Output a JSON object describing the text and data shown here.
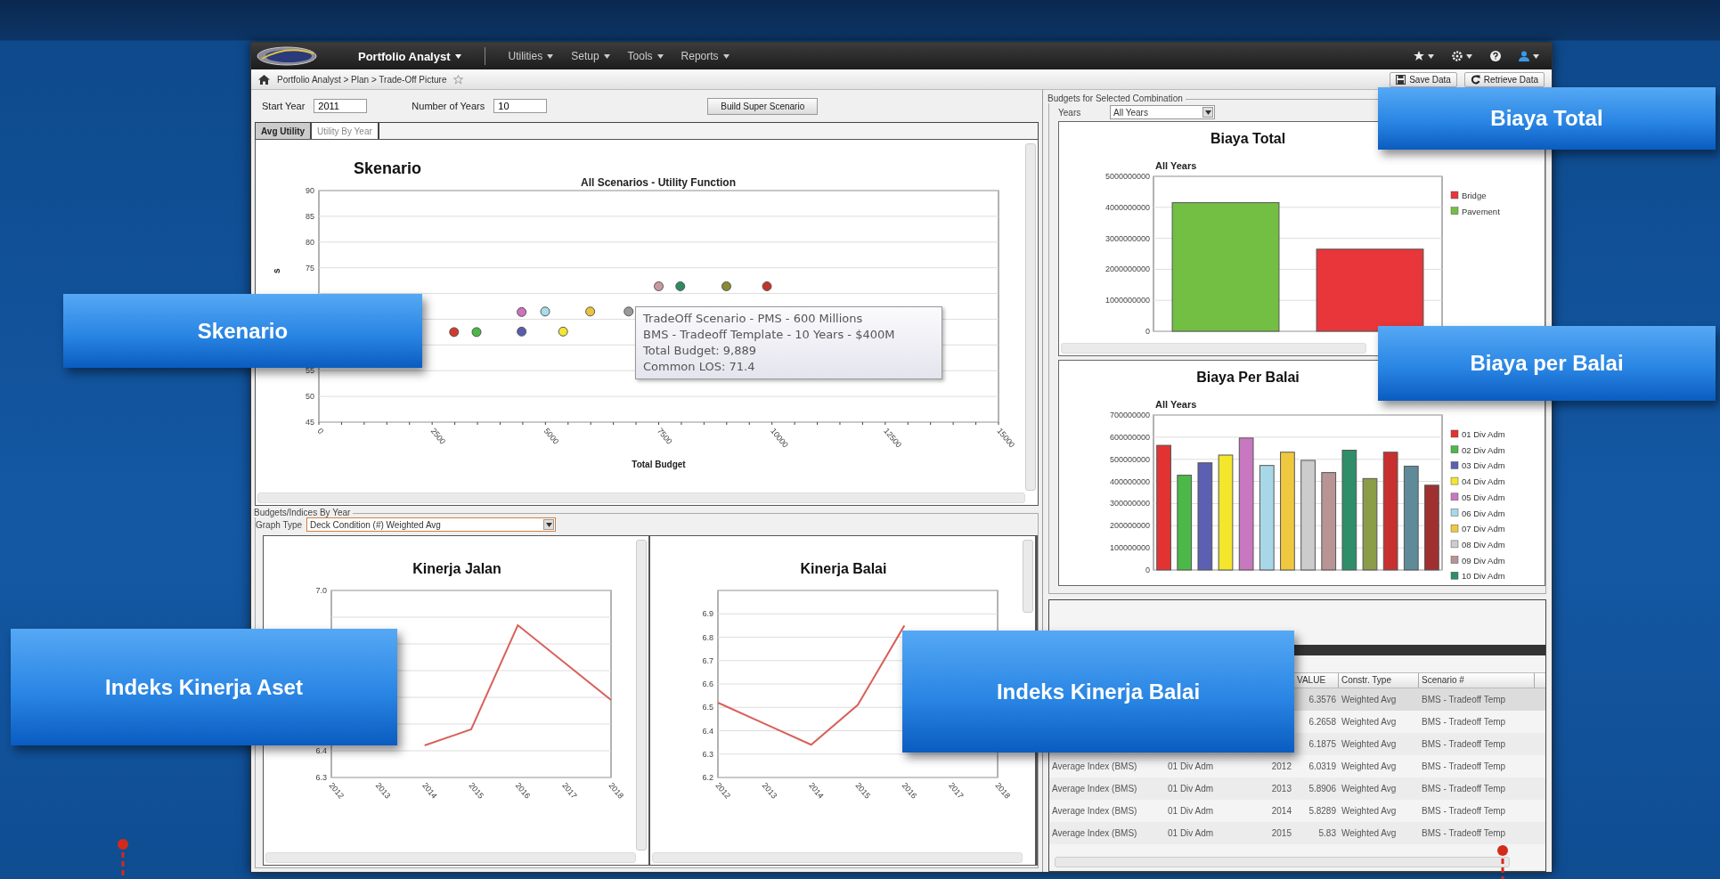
{
  "navbar": {
    "menus": [
      {
        "label": "Portfolio Analyst",
        "kind": "app"
      },
      {
        "label": "Utilities",
        "kind": "menu"
      },
      {
        "label": "Setup",
        "kind": "menu"
      },
      {
        "label": "Tools",
        "kind": "menu"
      },
      {
        "label": "Reports",
        "kind": "menu"
      }
    ]
  },
  "breadcrumb": {
    "path": "Portfolio Analyst > Plan > Trade-Off Picture",
    "buttons": [
      {
        "label": "Save Data",
        "kind": "save"
      },
      {
        "label": "Retrieve Data",
        "kind": "refresh"
      }
    ]
  },
  "scenario_form": {
    "start_year": {
      "label": "Start Year",
      "value": "2011"
    },
    "number_of_years": {
      "label": "Number of Years",
      "value": "10"
    },
    "build_button": "Build Super Scenario"
  },
  "tabs": [
    {
      "label": "Avg Utility",
      "selected": true
    },
    {
      "label": "Utility By Year",
      "selected": false
    }
  ],
  "scatter_panel": {
    "heading": "Skenario",
    "chart_data": {
      "type": "scatter",
      "title": "All Scenarios - Utility Function",
      "xlabel": "Total Budget",
      "ylabel": "s",
      "grid": true,
      "xlim": [
        0,
        15000
      ],
      "ylim": [
        45,
        90
      ],
      "xticks": [
        0,
        2500,
        5000,
        7500,
        10000,
        12500,
        15000
      ],
      "yticks": [
        45,
        50,
        55,
        75,
        80,
        85,
        90
      ],
      "x": [
        2983,
        3480,
        4475,
        4994,
        4475,
        5390,
        5989,
        6836,
        7500,
        7977,
        8994,
        9889
      ],
      "series": [
        {
          "color": "#d23a2e",
          "values": [
            62.5,
            null,
            null,
            null,
            null,
            null,
            null,
            null,
            null,
            null,
            null,
            null
          ]
        },
        {
          "color": "#4cb848",
          "values": [
            null,
            62.5,
            null,
            null,
            null,
            null,
            null,
            null,
            null,
            null,
            null,
            null
          ]
        },
        {
          "color": "#d070c0",
          "values": [
            null,
            null,
            66.4,
            null,
            null,
            null,
            null,
            null,
            null,
            null,
            null,
            null
          ]
        },
        {
          "color": "#a8dcea",
          "values": [
            null,
            null,
            null,
            66.5,
            null,
            null,
            null,
            null,
            null,
            null,
            null,
            null
          ]
        },
        {
          "color": "#5a5cb0",
          "values": [
            null,
            null,
            null,
            null,
            62.6,
            null,
            null,
            null,
            null,
            null,
            null,
            null
          ]
        },
        {
          "color": "#f2e632",
          "values": [
            null,
            null,
            null,
            null,
            null,
            62.6,
            null,
            null,
            null,
            null,
            null,
            null
          ]
        },
        {
          "color": "#e8c440",
          "values": [
            null,
            null,
            null,
            null,
            null,
            null,
            66.5,
            null,
            null,
            null,
            null,
            null
          ]
        },
        {
          "color": "#9a9a9a",
          "values": [
            null,
            null,
            null,
            null,
            null,
            null,
            null,
            66.5,
            null,
            null,
            null,
            null
          ]
        },
        {
          "color": "#c89aa0",
          "values": [
            null,
            null,
            null,
            null,
            null,
            null,
            null,
            null,
            71.4,
            null,
            null,
            null
          ]
        },
        {
          "color": "#2f8a60",
          "values": [
            null,
            null,
            null,
            null,
            null,
            null,
            null,
            null,
            null,
            71.4,
            null,
            null
          ]
        },
        {
          "color": "#8a8a30",
          "values": [
            null,
            null,
            null,
            null,
            null,
            null,
            null,
            null,
            null,
            null,
            71.4,
            null
          ]
        },
        {
          "color": "#c0362a",
          "values": [
            null,
            null,
            null,
            null,
            null,
            null,
            null,
            null,
            null,
            null,
            null,
            71.4
          ]
        }
      ]
    },
    "tooltip": [
      "TradeOff Scenario - PMS - 600 Millions",
      "BMS - Tradeoff Template - 10 Years - $400M",
      "Total Budget: 9,889",
      "Common LOS: 71.4"
    ]
  },
  "indices_group": {
    "legend": "Budgets/Indices By Year",
    "graph_type": {
      "label": "Graph Type",
      "value": "Deck Condition (#) Weighted Avg"
    },
    "charts": [
      {
        "heading": "Kinerja Jalan",
        "chart_data": {
          "type": "line",
          "grid": true,
          "x": [
            "2012",
            "2013",
            "2014",
            "2015",
            "2016",
            "2017",
            "2018"
          ],
          "ylim": [
            6.3,
            7.0
          ],
          "yticks": [
            {
              "value": 6.3,
              "label": "6.3"
            },
            {
              "value": 6.4,
              "label": "6.4"
            },
            {
              "value": 7.0,
              "label": "7.0"
            }
          ],
          "series": [
            {
              "color": "#d9605a",
              "values": [
                null,
                null,
                6.42,
                6.48,
                6.87,
                6.73,
                6.59
              ]
            }
          ]
        }
      },
      {
        "heading": "Kinerja Balai",
        "chart_data": {
          "type": "line",
          "grid": true,
          "x": [
            "2012",
            "2013",
            "2014",
            "2015",
            "2016",
            "2017",
            "2018"
          ],
          "ylim": [
            6.2,
            7.0
          ],
          "yticks": [
            {
              "value": 6.2,
              "label": "6.2"
            },
            {
              "value": 6.3,
              "label": "6.3"
            },
            {
              "value": 6.4,
              "label": "6.4"
            },
            {
              "value": 6.5,
              "label": "6.5"
            },
            {
              "value": 6.6,
              "label": "6.6"
            },
            {
              "value": 6.7,
              "label": "6.7"
            },
            {
              "value": 6.8,
              "label": "6.8"
            },
            {
              "value": 6.9,
              "label": "6.9"
            }
          ],
          "series": [
            {
              "color": "#d9605a",
              "values": [
                6.52,
                6.43,
                6.34,
                6.51,
                6.85,
                null,
                null
              ]
            }
          ]
        }
      }
    ]
  },
  "budgets_group": {
    "legend": "Budgets for Selected Combination",
    "years": {
      "label": "Years",
      "value": "All Years"
    },
    "total_chart": {
      "heading": "Biaya Total",
      "subtitle": "All Years",
      "chart_data": {
        "type": "bar",
        "grid": true,
        "legend": "right",
        "ylim": [
          0,
          5000000000
        ],
        "yticks": [
          {
            "value": 0,
            "label": "0"
          },
          {
            "value": 1000000000,
            "label": "1000000000"
          },
          {
            "value": 2000000000,
            "label": "2000000000"
          },
          {
            "value": 3000000000,
            "label": "3000000000"
          },
          {
            "value": 4000000000,
            "label": "4000000000"
          },
          {
            "value": 5000000000,
            "label": "5000000000"
          }
        ],
        "series": [
          {
            "name": "Bridge",
            "color": "#e8363a",
            "values": [
              null,
              2650000000
            ]
          },
          {
            "name": "Pavement",
            "color": "#72bf44",
            "values": [
              4150000000,
              null
            ]
          }
        ]
      }
    },
    "division_chart": {
      "heading": "Biaya Per Balai",
      "subtitle": "All Years",
      "chart_data": {
        "type": "bar",
        "grid": true,
        "legend": "right",
        "ylim": [
          0,
          700000000
        ],
        "yticks": [
          {
            "value": 0,
            "label": "0"
          },
          {
            "value": 100000000,
            "label": "100000000"
          },
          {
            "value": 200000000,
            "label": "200000000"
          },
          {
            "value": 300000000,
            "label": "300000000"
          },
          {
            "value": 400000000,
            "label": "400000000"
          },
          {
            "value": 500000000,
            "label": "500000000"
          },
          {
            "value": 600000000,
            "label": "600000000"
          },
          {
            "value": 700000000,
            "label": "700000000"
          }
        ],
        "series": [
          {
            "name": "01 Div Adm",
            "color": "#e23232",
            "values": [
              563000000,
              null,
              null,
              null,
              null,
              null,
              null,
              null,
              null,
              null,
              null,
              null,
              null,
              null
            ]
          },
          {
            "name": "02 Div Adm",
            "color": "#4cb848",
            "values": [
              null,
              428000000,
              null,
              null,
              null,
              null,
              null,
              null,
              null,
              null,
              null,
              null,
              null,
              null
            ]
          },
          {
            "name": "03 Div Adm",
            "color": "#5c5fb2",
            "values": [
              null,
              null,
              484000000,
              null,
              null,
              null,
              null,
              null,
              null,
              null,
              null,
              null,
              null,
              null
            ]
          },
          {
            "name": "04 Div Adm",
            "color": "#f4e62c",
            "values": [
              null,
              null,
              null,
              519000000,
              null,
              null,
              null,
              null,
              null,
              null,
              null,
              null,
              null,
              null
            ]
          },
          {
            "name": "05 Div Adm",
            "color": "#c878c0",
            "values": [
              null,
              null,
              null,
              null,
              596000000,
              null,
              null,
              null,
              null,
              null,
              null,
              null,
              null,
              null
            ]
          },
          {
            "name": "06 Div Adm",
            "color": "#a8d8e8",
            "values": [
              null,
              null,
              null,
              null,
              null,
              472000000,
              null,
              null,
              null,
              null,
              null,
              null,
              null,
              null
            ]
          },
          {
            "name": "07 Div Adm",
            "color": "#f0c840",
            "values": [
              null,
              null,
              null,
              null,
              null,
              null,
              532000000,
              null,
              null,
              null,
              null,
              null,
              null,
              null
            ]
          },
          {
            "name": "08 Div Adm",
            "color": "#cccccc",
            "values": [
              null,
              null,
              null,
              null,
              null,
              null,
              null,
              495000000,
              null,
              null,
              null,
              null,
              null,
              null
            ]
          },
          {
            "name": "09 Div Adm",
            "color": "#b89494",
            "values": [
              null,
              null,
              null,
              null,
              null,
              null,
              null,
              null,
              440000000,
              null,
              null,
              null,
              null,
              null
            ]
          },
          {
            "name": "10 Div Adm",
            "color": "#2e8e6a",
            "values": [
              null,
              null,
              null,
              null,
              null,
              null,
              null,
              null,
              null,
              541000000,
              null,
              null,
              null,
              null
            ]
          },
          {
            "color": "#8a9c48",
            "values": [
              null,
              null,
              null,
              null,
              null,
              null,
              null,
              null,
              null,
              null,
              413000000,
              null,
              null,
              null
            ]
          },
          {
            "color": "#c83030",
            "values": [
              null,
              null,
              null,
              null,
              null,
              null,
              null,
              null,
              null,
              null,
              null,
              532000000,
              null,
              null
            ]
          },
          {
            "color": "#5f8a98",
            "values": [
              null,
              null,
              null,
              null,
              null,
              null,
              null,
              null,
              null,
              null,
              null,
              null,
              469000000,
              null
            ]
          },
          {
            "color": "#a03030",
            "values": [
              null,
              null,
              null,
              null,
              null,
              null,
              null,
              null,
              null,
              null,
              null,
              null,
              null,
              383000000
            ]
          }
        ]
      }
    }
  },
  "table": {
    "columns": [
      null,
      null,
      null,
      "VALUE",
      "Constr. Type",
      "Scenario #"
    ],
    "rows": [
      {
        "selected": true,
        "cells": [
          null,
          null,
          null,
          "6.3576",
          "Weighted Avg",
          "BMS - Tradeoff Temp"
        ]
      },
      {
        "selected": false,
        "cells": [
          null,
          null,
          null,
          "6.2658",
          "Weighted Avg",
          "BMS - Tradeoff Temp"
        ]
      },
      {
        "selected": false,
        "cells": [
          null,
          null,
          null,
          "6.1875",
          "Weighted Avg",
          "BMS - Tradeoff Temp"
        ]
      },
      {
        "selected": false,
        "cells": [
          "Average Index (BMS)",
          "01 Div Adm",
          "2012",
          "6.0319",
          "Weighted Avg",
          "BMS - Tradeoff Temp"
        ]
      },
      {
        "selected": false,
        "cells": [
          "Average Index (BMS)",
          "01 Div Adm",
          "2013",
          "5.8906",
          "Weighted Avg",
          "BMS - Tradeoff Temp"
        ]
      },
      {
        "selected": false,
        "cells": [
          "Average Index (BMS)",
          "01 Div Adm",
          "2014",
          "5.8289",
          "Weighted Avg",
          "BMS - Tradeoff Temp"
        ]
      },
      {
        "selected": false,
        "cells": [
          "Average Index (BMS)",
          "01 Div Adm",
          "2015",
          "5.83",
          "Weighted Avg",
          "BMS - Tradeoff Temp"
        ]
      }
    ]
  },
  "callouts": [
    {
      "text": "Biaya Total"
    },
    {
      "text": "Skenario"
    },
    {
      "text": "Biaya per Balai"
    },
    {
      "text": "Indeks Kinerja Aset"
    },
    {
      "text": "Indeks Kinerja Balai"
    }
  ]
}
